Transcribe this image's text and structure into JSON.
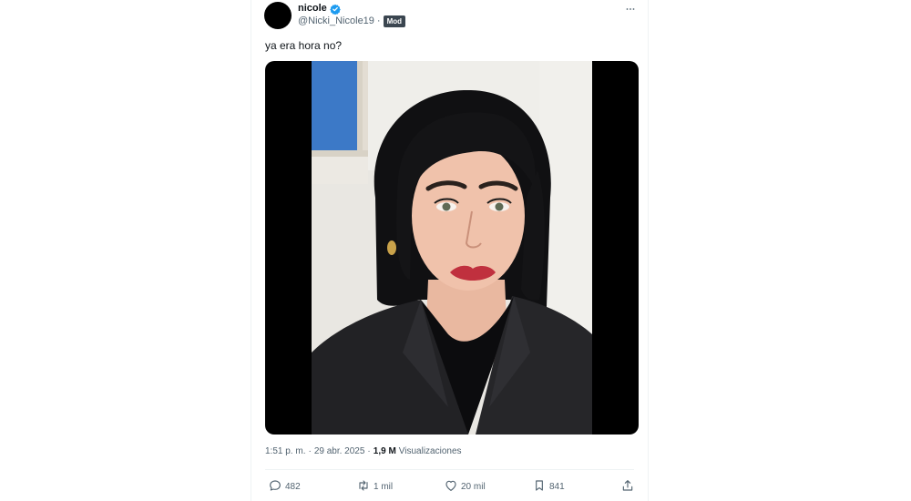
{
  "tweet": {
    "display_name": "nicole",
    "handle": "@Nicki_Nicole19",
    "separator": "·",
    "badge": "Mod",
    "text": "ya era hora no?",
    "time": "1:51 p. m.",
    "date_sep": "·",
    "date": "29 abr. 2025",
    "views_sep": "·",
    "views_count": "1,9 M",
    "views_label": "Visualizaciones"
  },
  "actions": {
    "replies": "482",
    "reposts": "1 mil",
    "likes": "20 mil",
    "bookmarks": "841"
  },
  "colors": {
    "verified": "#1d9bf0",
    "secondary_text": "#536471",
    "badge_bg": "#3b4650"
  },
  "icons": {
    "more": "more-horizontal-icon",
    "reply": "reply-icon",
    "repost": "repost-icon",
    "like": "heart-icon",
    "bookmark": "bookmark-icon",
    "share": "share-icon",
    "verified": "verified-badge-icon"
  }
}
